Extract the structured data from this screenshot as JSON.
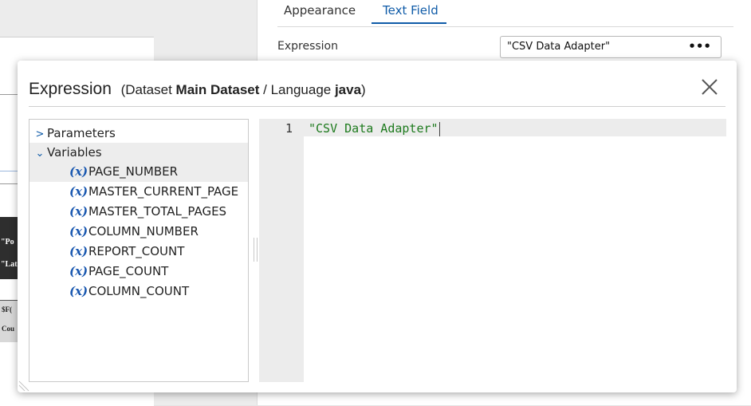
{
  "background": {
    "tabs": [
      "Appearance",
      "Text Field"
    ],
    "active_tab": "Text Field",
    "expression_label": "Expression",
    "expression_value": "\"CSV Data Adapter\"",
    "more_button": "•••",
    "canvas_fragments": [
      "\"Po",
      "\"Lat",
      "$F(",
      "Cou"
    ]
  },
  "dialog": {
    "title": "Expression",
    "subtitle_prefix": "(Dataset ",
    "dataset": "Main Dataset",
    "subtitle_mid": " / Language ",
    "language": "java",
    "subtitle_suffix": ")",
    "close_icon": "close-x-icon",
    "tree": {
      "groups": [
        {
          "label": "Parameters",
          "expanded": false,
          "chevron": ">"
        },
        {
          "label": "Variables",
          "expanded": true,
          "chevron": "⌄"
        }
      ],
      "variable_icon": "(x)",
      "variables": [
        "PAGE_NUMBER",
        "MASTER_CURRENT_PAGE",
        "MASTER_TOTAL_PAGES",
        "COLUMN_NUMBER",
        "REPORT_COUNT",
        "PAGE_COUNT",
        "COLUMN_COUNT"
      ]
    },
    "editor": {
      "line_number": "1",
      "code": "\"CSV Data Adapter\""
    }
  },
  "colors": {
    "accent": "#0f5ba8",
    "string_literal": "#1d7a1d",
    "variable_icon": "#1a58b0"
  }
}
